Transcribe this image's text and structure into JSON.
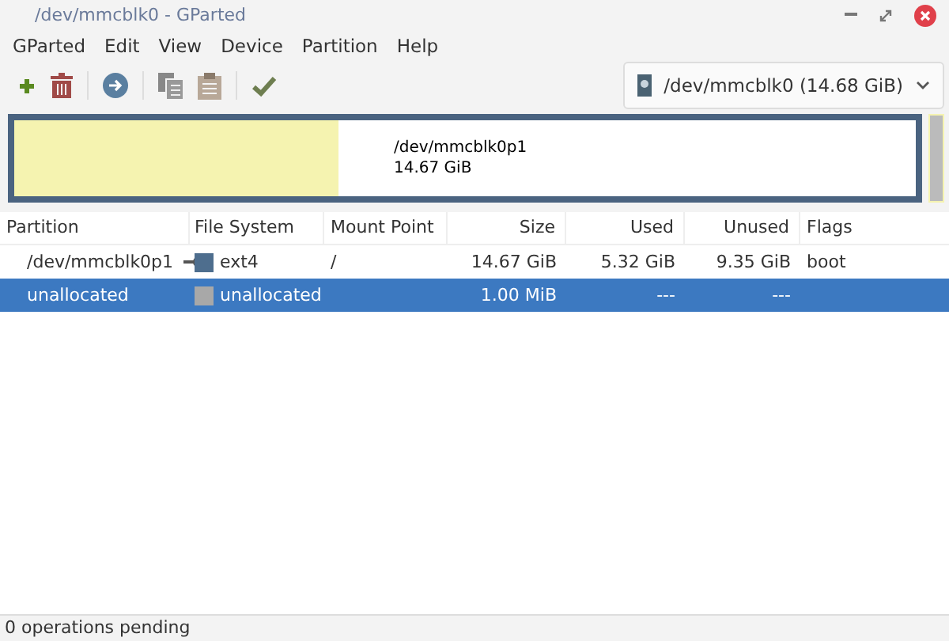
{
  "window": {
    "title": "/dev/mmcblk0 - GParted"
  },
  "menu": [
    "GParted",
    "Edit",
    "View",
    "Device",
    "Partition",
    "Help"
  ],
  "device": {
    "label": "/dev/mmcblk0  (14.68 GiB)"
  },
  "disk_map": {
    "name": "/dev/mmcblk0p1",
    "size": "14.67 GiB",
    "level": 0.36
  },
  "table": {
    "columns": [
      "Partition",
      "File System",
      "Mount Point",
      "Size",
      "Used",
      "Unused",
      "Flags"
    ],
    "rows": [
      {
        "partition": "/dev/mmcblk0p1",
        "mounted": true,
        "color": "#4e6e8e",
        "filesystem": "ext4",
        "mount_point": "/",
        "size": "14.67 GiB",
        "used": "5.32 GiB",
        "unused": "9.35 GiB",
        "flags": "boot",
        "selected": false
      },
      {
        "partition": "unallocated",
        "mounted": false,
        "color": "#a8a8a8",
        "filesystem": "unallocated",
        "mount_point": "",
        "size": "1.00 MiB",
        "used": "---",
        "unused": "---",
        "flags": "",
        "selected": true
      }
    ]
  },
  "status_bar": "0 operations pending"
}
